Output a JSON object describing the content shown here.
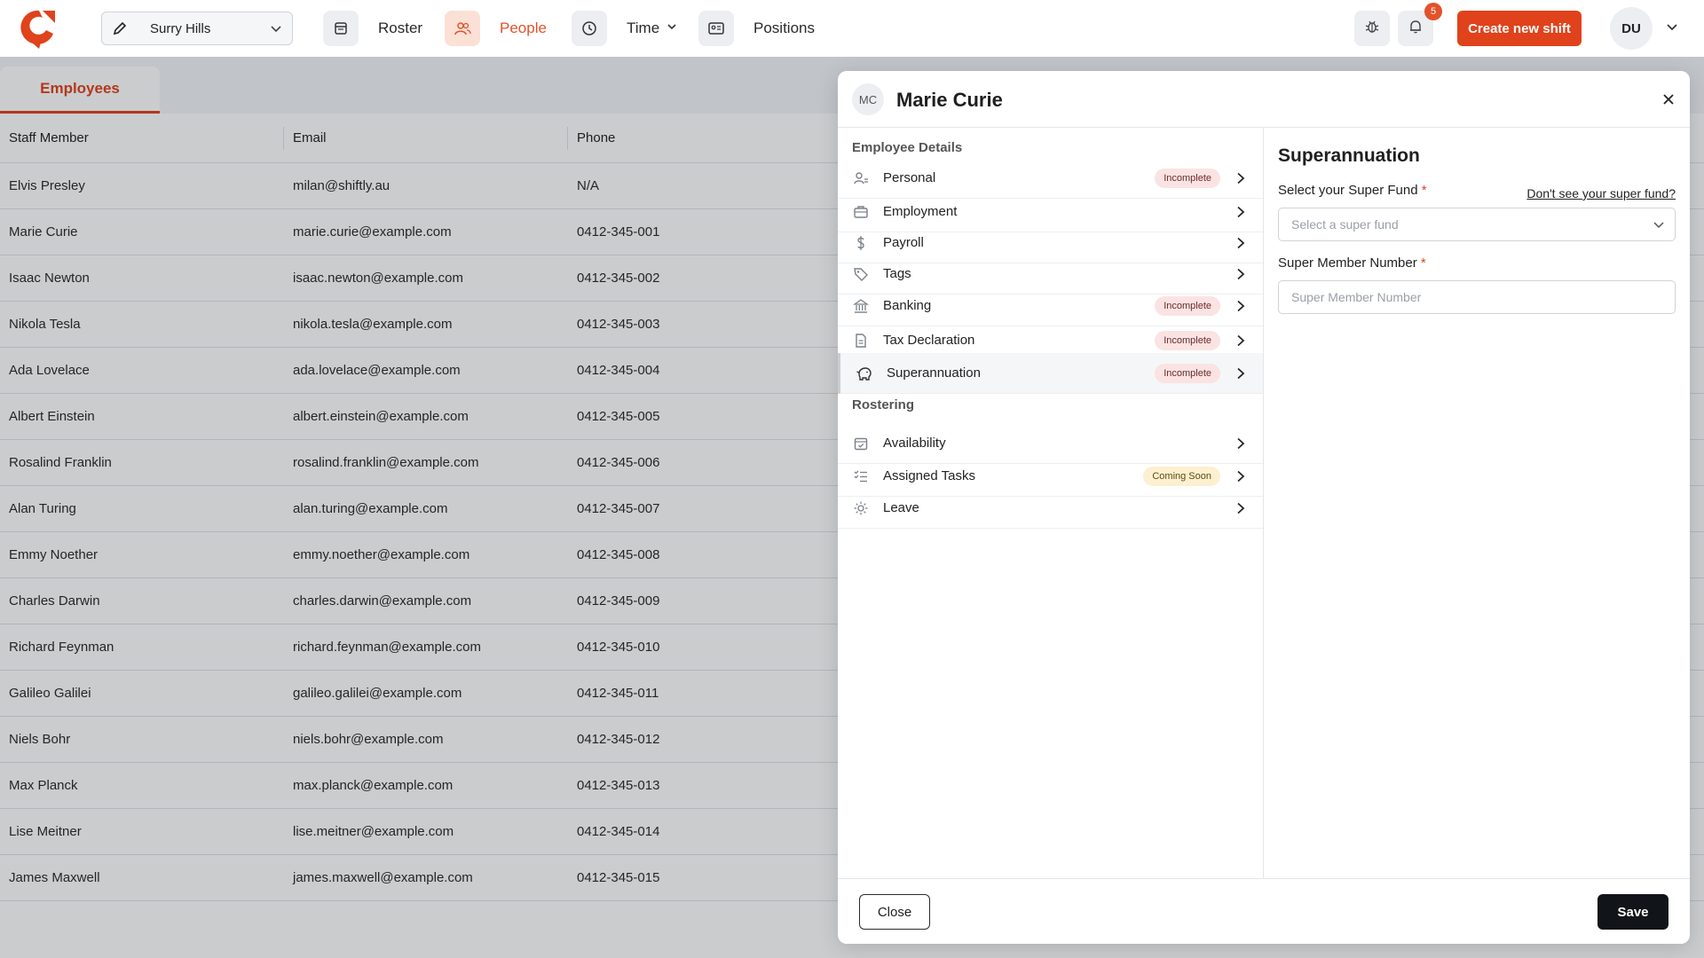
{
  "header": {
    "location": "Surry Hills",
    "nav": [
      {
        "label": "Roster",
        "icon": "calendar-icon"
      },
      {
        "label": "People",
        "icon": "people-icon"
      },
      {
        "label": "Time",
        "icon": "clock-icon"
      },
      {
        "label": "Positions",
        "icon": "id-card-icon"
      }
    ],
    "notification_count": "5",
    "create_label": "Create new shift",
    "user_initials": "DU"
  },
  "list": {
    "tab_label": "Employees",
    "columns": [
      "Staff Member",
      "Email",
      "Phone"
    ],
    "rows": [
      [
        "Elvis Presley",
        "milan@shiftly.au",
        "N/A"
      ],
      [
        "Marie Curie",
        "marie.curie@example.com",
        "0412-345-001"
      ],
      [
        "Isaac Newton",
        "isaac.newton@example.com",
        "0412-345-002"
      ],
      [
        "Nikola Tesla",
        "nikola.tesla@example.com",
        "0412-345-003"
      ],
      [
        "Ada Lovelace",
        "ada.lovelace@example.com",
        "0412-345-004"
      ],
      [
        "Albert Einstein",
        "albert.einstein@example.com",
        "0412-345-005"
      ],
      [
        "Rosalind Franklin",
        "rosalind.franklin@example.com",
        "0412-345-006"
      ],
      [
        "Alan Turing",
        "alan.turing@example.com",
        "0412-345-007"
      ],
      [
        "Emmy Noether",
        "emmy.noether@example.com",
        "0412-345-008"
      ],
      [
        "Charles Darwin",
        "charles.darwin@example.com",
        "0412-345-009"
      ],
      [
        "Richard Feynman",
        "richard.feynman@example.com",
        "0412-345-010"
      ],
      [
        "Galileo Galilei",
        "galileo.galilei@example.com",
        "0412-345-011"
      ],
      [
        "Niels Bohr",
        "niels.bohr@example.com",
        "0412-345-012"
      ],
      [
        "Max Planck",
        "max.planck@example.com",
        "0412-345-013"
      ],
      [
        "Lise Meitner",
        "lise.meitner@example.com",
        "0412-345-014"
      ],
      [
        "James Maxwell",
        "james.maxwell@example.com",
        "0412-345-015"
      ]
    ]
  },
  "panel": {
    "initials": "MC",
    "name": "Marie Curie",
    "sections": [
      {
        "title": "Employee Details",
        "items": [
          {
            "label": "Personal",
            "icon": "user-icon",
            "badge": "Incomplete"
          },
          {
            "label": "Employment",
            "icon": "briefcase-icon",
            "badge": ""
          },
          {
            "label": "Payroll",
            "icon": "dollar-icon",
            "badge": ""
          },
          {
            "label": "Tags",
            "icon": "tag-icon",
            "badge": ""
          },
          {
            "label": "Banking",
            "icon": "bank-icon",
            "badge": "Incomplete"
          },
          {
            "label": "Tax Declaration",
            "icon": "document-icon",
            "badge": "Incomplete"
          },
          {
            "label": "Superannuation",
            "icon": "piggy-bank-icon",
            "badge": "Incomplete",
            "active": true
          }
        ]
      },
      {
        "title": "Rostering",
        "items": [
          {
            "label": "Availability",
            "icon": "calendar-check-icon",
            "badge": ""
          },
          {
            "label": "Assigned Tasks",
            "icon": "checklist-icon",
            "badge": "Coming Soon"
          },
          {
            "label": "Leave",
            "icon": "sun-icon",
            "badge": ""
          }
        ]
      }
    ],
    "form": {
      "title": "Superannuation",
      "fund_label": "Select your Super Fund",
      "fund_link": "Don't see your super fund?",
      "fund_placeholder": "Select a super fund",
      "member_label": "Super Member Number",
      "member_placeholder": "Super Member Number",
      "required_mark": "*"
    },
    "close_label": "Close",
    "save_label": "Save"
  },
  "colors": {
    "brand": "#e0421b",
    "dark_button": "#111418",
    "incomplete_badge": "#fbe3e3",
    "coming_soon_badge": "#fdf0d0"
  }
}
